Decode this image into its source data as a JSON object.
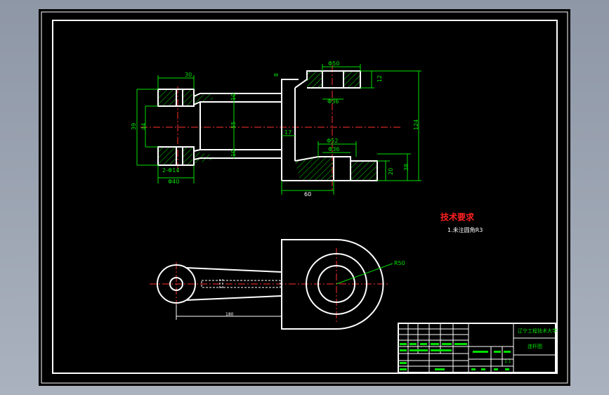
{
  "drawing": {
    "tech_title": "技术要求",
    "tech_note": "1.未注圆角R3",
    "dims": {
      "d30": "30",
      "d8": "8",
      "d_phi50": "Φ50",
      "d12": "12",
      "d_phi36": "Φ36",
      "d10a": "10",
      "d55": "55",
      "d39": "39",
      "d44": "44",
      "d124": "124",
      "d17": "17",
      "d_phi52": "Φ52",
      "d_phi36b": "Φ36",
      "d10b": "10",
      "d2phi14": "2-Φ14",
      "d_phi40": "Φ40",
      "d60": "60",
      "d20": "20",
      "d38": "38",
      "r50": "R50",
      "d180": "180"
    },
    "title_block": {
      "university": "辽宁工程技术大学",
      "part_name": "连杆图",
      "scale_label": "1:1"
    }
  }
}
